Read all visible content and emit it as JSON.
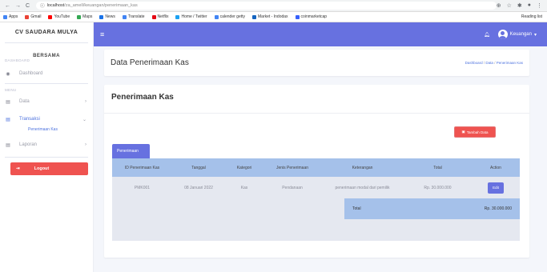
{
  "browser": {
    "url_host": "localhost",
    "url_path": "/za_amell/keuangan/penerimaan_kas",
    "bookmarks": [
      "Apps",
      "Gmail",
      "YouTube",
      "Maps",
      "News",
      "Translate",
      "Netflix",
      "Home / Twitter",
      "calender getty",
      "Market - Indodax",
      "coinmarketcap"
    ],
    "reading_list": "Reading list"
  },
  "sidebar": {
    "brand": "CV SAUDARA MULYA",
    "bersama": "BERSAMA",
    "dashboard_section": "DASHBOARD",
    "dashboard_label": "Dashboard",
    "menu_section": "MENU",
    "data_label": "Data",
    "transaksi_label": "Transaksi",
    "sub_penerimaan": "Penerimaan Kas",
    "laporan_label": "Laporan",
    "logout_label": "Logout"
  },
  "topbar": {
    "user_name": "Keuangan"
  },
  "header": {
    "title": "Data Penerimaan Kas",
    "crumb_1": "Dashboard",
    "crumb_2": "Data",
    "crumb_3": "Penerimaan Kas"
  },
  "main": {
    "title": "Penerimaan Kas",
    "tambah_label": "Tambah Data",
    "tab_label": "Penerimaan",
    "columns": [
      "ID Penerimaan Kas",
      "Tanggal",
      "Kategori",
      "Jenis Penerimaan",
      "Keterangan",
      "Total",
      "Action"
    ],
    "rows": [
      {
        "id": "PMK001",
        "tanggal": "08 Januari 2022",
        "kategori": "Kas",
        "jenis": "Pendanaan",
        "keterangan": "penerimaan modal dari pemilik",
        "total": "Rp. 30.000.000",
        "action": "Edit"
      }
    ],
    "total_label": "Total",
    "total_value": "Rp. 30.000.000"
  },
  "colors": {
    "primary": "#6771e0",
    "danger": "#ef5350",
    "table_header": "#a5c1ea"
  }
}
